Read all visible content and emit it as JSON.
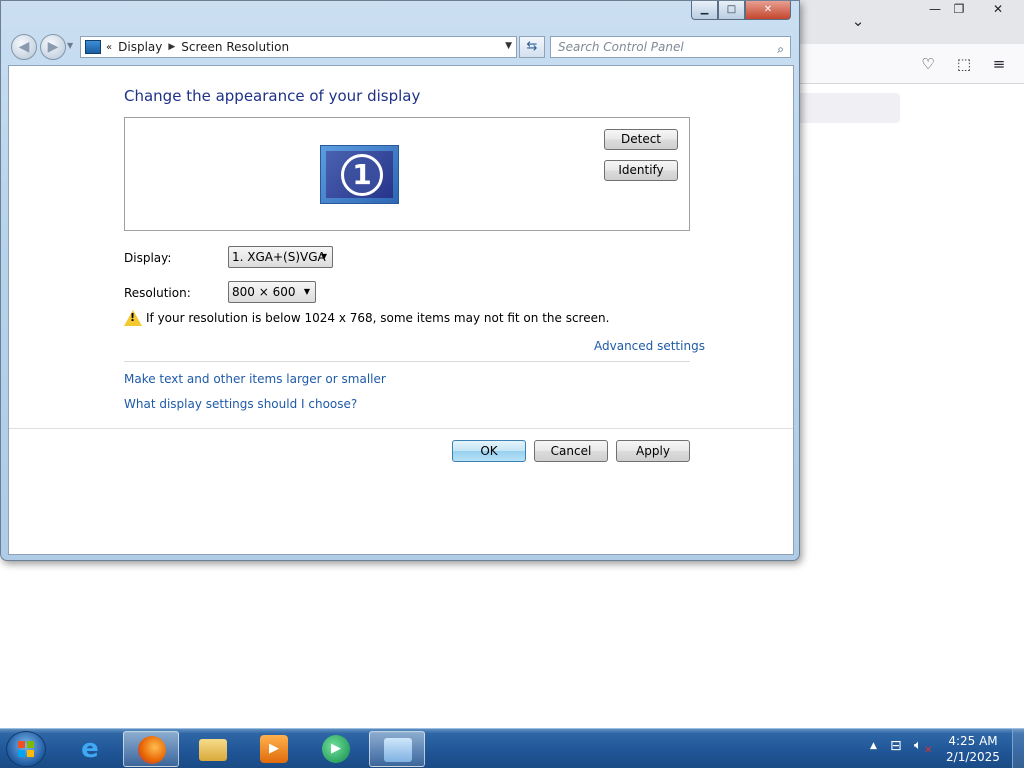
{
  "window": {
    "minimize_icon": "minimize-icon",
    "maximize_icon": "maximize-icon",
    "close_icon": "close-icon"
  },
  "navigation": {
    "back_icon": "back-arrow-icon",
    "forward_icon": "forward-arrow-icon",
    "breadcrumb": [
      "Display",
      "Screen Resolution"
    ],
    "search_placeholder": "Search Control Panel"
  },
  "page": {
    "title": "Change the appearance of your display",
    "detect_label": "Detect",
    "identify_label": "Identify",
    "monitor_number": "1",
    "display_label": "Display:",
    "display_value": "1. XGA+(S)VGA",
    "resolution_label": "Resolution:",
    "resolution_value": "800 × 600",
    "warning_text": "If your resolution is below 1024 x 768, some items may not fit on the screen.",
    "advanced_link": "Advanced settings",
    "text_size_link": "Make text and other items larger or smaller",
    "help_link": "What display settings should I choose?"
  },
  "buttons": {
    "ok": "OK",
    "cancel": "Cancel",
    "apply": "Apply"
  },
  "taskbar": {
    "items": [
      "internet-explorer",
      "firefox",
      "file-explorer",
      "media-player",
      "media-center",
      "control-panel"
    ],
    "active": "control-panel"
  },
  "tray": {
    "time": "4:25 AM",
    "date": "2/1/2025",
    "volume_muted": true
  }
}
